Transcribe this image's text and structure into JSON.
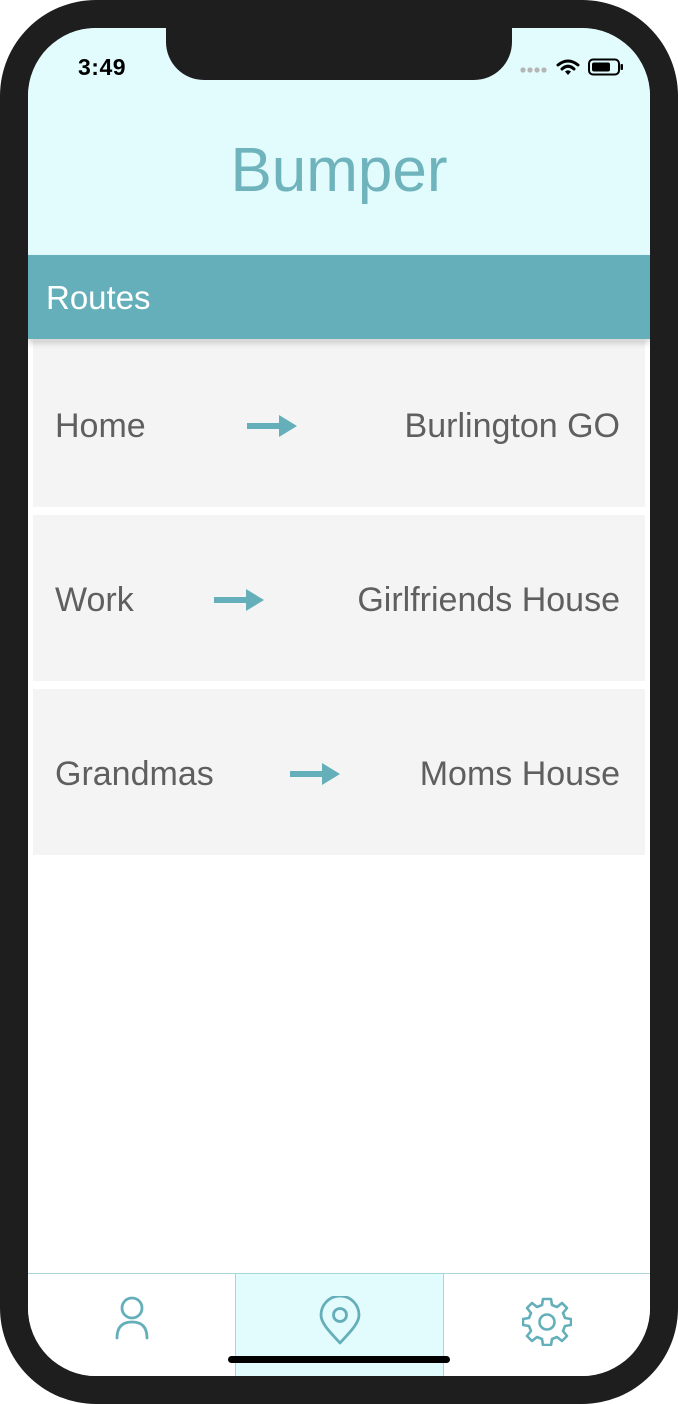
{
  "status_bar": {
    "time": "3:49"
  },
  "header": {
    "title": "Bumper"
  },
  "section": {
    "title": "Routes"
  },
  "routes": [
    {
      "from": "Home",
      "to": "Burlington GO"
    },
    {
      "from": "Work",
      "to": "Girlfriends House"
    },
    {
      "from": "Grandmas",
      "to": "Moms House"
    }
  ],
  "tabs": [
    {
      "icon": "user-icon",
      "active": false
    },
    {
      "icon": "location-pin-icon",
      "active": true
    },
    {
      "icon": "gear-icon",
      "active": false
    }
  ],
  "colors": {
    "accent": "#64afb9",
    "header_bg": "#e2fbfd",
    "title_color": "#6fb3bd",
    "card_bg": "#f4f4f4",
    "text": "#5f5f5f"
  }
}
